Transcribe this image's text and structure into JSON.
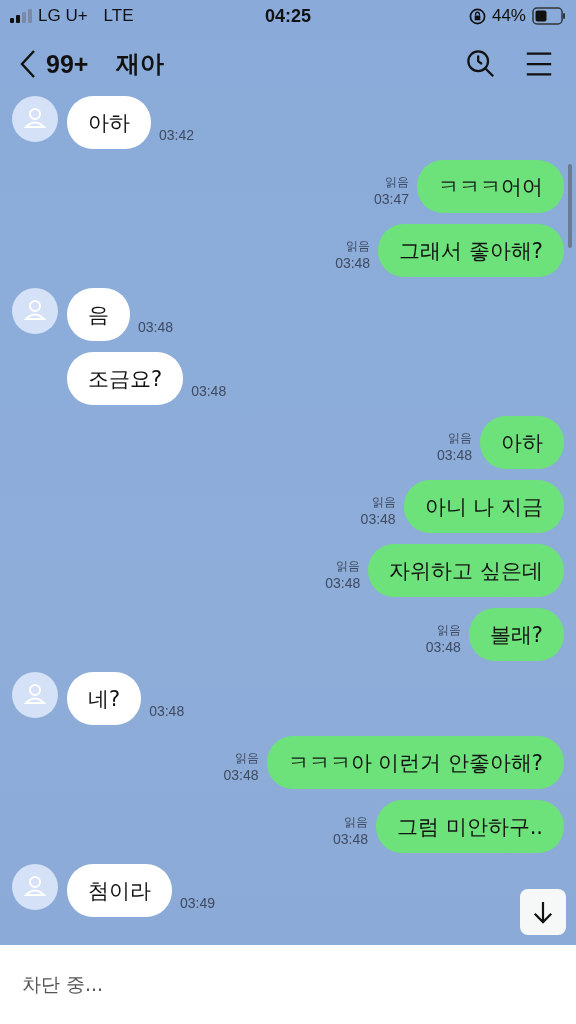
{
  "status_bar": {
    "carrier": "LG U+",
    "network": "LTE",
    "time": "04:25",
    "battery": "44%"
  },
  "header": {
    "unread": "99+",
    "title": "재아"
  },
  "messages": [
    {
      "kind": "in",
      "avatar": true,
      "text": "아하",
      "time": "03:42"
    },
    {
      "kind": "out",
      "read": "읽음",
      "text": "ㅋㅋㅋ어어",
      "time": "03:47"
    },
    {
      "kind": "out",
      "read": "읽음",
      "text": "그래서 좋아해?",
      "time": "03:48"
    },
    {
      "kind": "in",
      "avatar": true,
      "text": "음",
      "time": "03:48"
    },
    {
      "kind": "in",
      "avatar": false,
      "text": "조금요?",
      "time": "03:48"
    },
    {
      "kind": "out",
      "read": "읽음",
      "text": "아하",
      "time": "03:48"
    },
    {
      "kind": "out",
      "read": "읽음",
      "text": "아니 나 지금",
      "time": "03:48"
    },
    {
      "kind": "out",
      "read": "읽음",
      "text": "자위하고 싶은데",
      "time": "03:48"
    },
    {
      "kind": "out",
      "read": "읽음",
      "text": "볼래?",
      "time": "03:48"
    },
    {
      "kind": "in",
      "avatar": true,
      "text": "네?",
      "time": "03:48"
    },
    {
      "kind": "out",
      "read": "읽음",
      "text": "ㅋㅋㅋ아 이런거 안좋아해?",
      "time": "03:48"
    },
    {
      "kind": "out",
      "read": "읽음",
      "text": "그럼 미안하구..",
      "time": "03:48"
    },
    {
      "kind": "in",
      "avatar": true,
      "text": "첨이라",
      "time": "03:49"
    }
  ],
  "footer": {
    "notice": "차단 중..."
  }
}
